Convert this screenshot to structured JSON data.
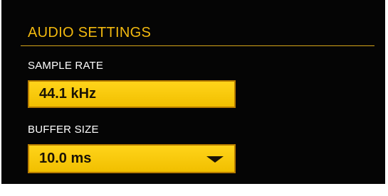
{
  "audio_settings": {
    "title": "AUDIO SETTINGS",
    "sample_rate": {
      "label": "SAMPLE RATE",
      "value": "44.1 kHz"
    },
    "buffer_size": {
      "label": "BUFFER SIZE",
      "value": "10.0 ms",
      "control_icon": "dropdown-triangle"
    }
  },
  "colors": {
    "panel_background": "#050505",
    "accent": "#f2b90f",
    "field_background": "#ffd41a",
    "text_dark": "#1a1305"
  }
}
